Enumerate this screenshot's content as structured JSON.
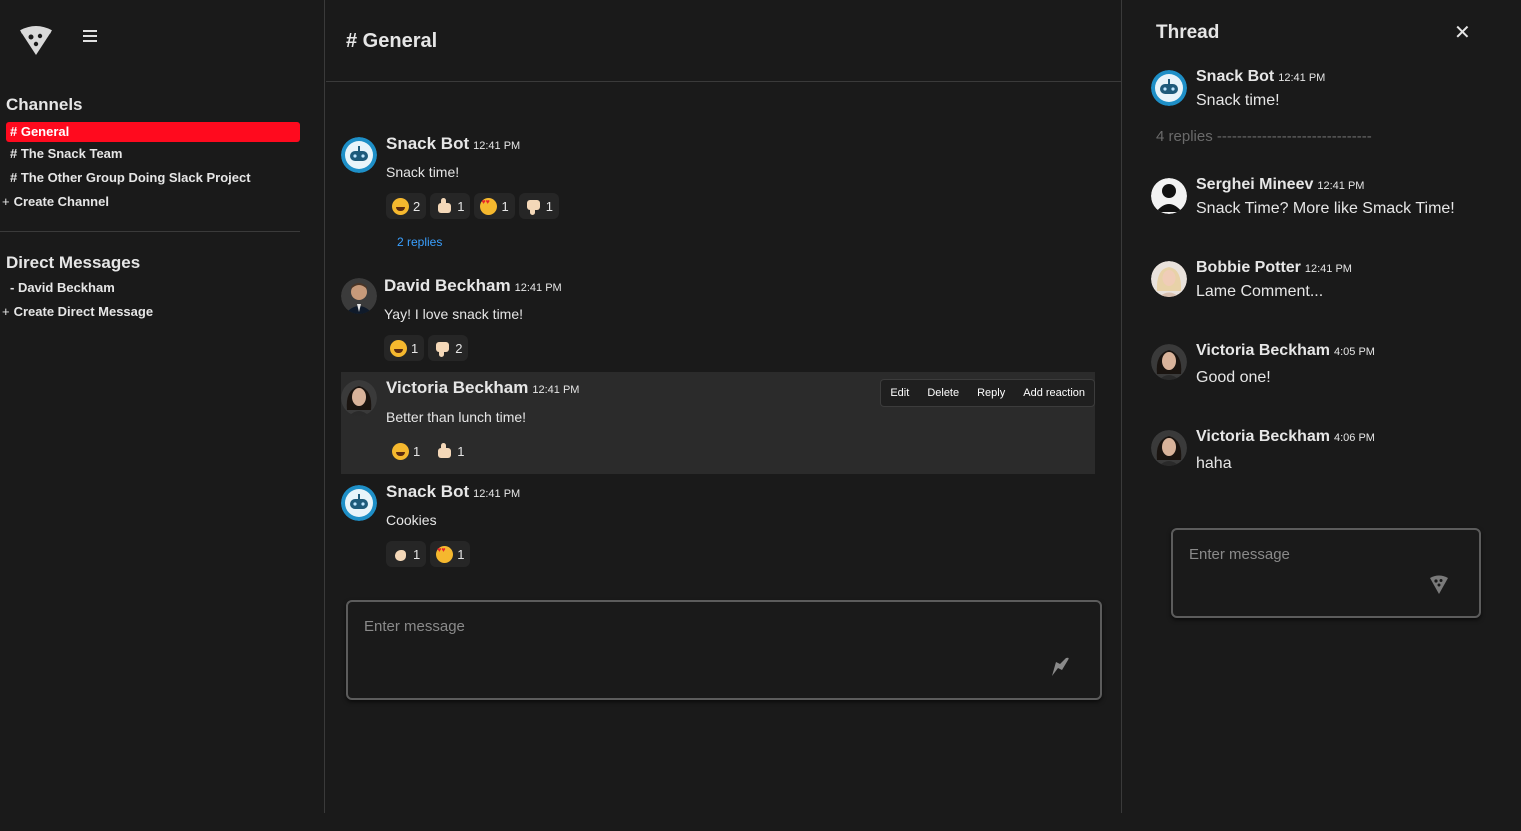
{
  "sidebar": {
    "channels_title": "Channels",
    "channels": [
      {
        "label": "# General",
        "active": true
      },
      {
        "label": "# The Snack Team",
        "active": false
      },
      {
        "label": "# The Other Group Doing Slack Project",
        "active": false
      }
    ],
    "create_channel": "Create Channel",
    "dm_title": "Direct Messages",
    "dms": [
      {
        "label": "- David Beckham"
      }
    ],
    "create_dm": "Create Direct Message",
    "plus": "+"
  },
  "main": {
    "title": "# General",
    "messages": [
      {
        "author": "Snack Bot",
        "time": "12:41 PM",
        "text": "Snack time!",
        "avatar": "robot-avatar",
        "reactions": [
          {
            "emoji": "laugh",
            "count": "2"
          },
          {
            "emoji": "thumbup",
            "count": "1"
          },
          {
            "emoji": "love",
            "count": "1"
          },
          {
            "emoji": "thumbdown",
            "count": "1"
          }
        ],
        "replies": "2 replies"
      },
      {
        "author": "David Beckham",
        "time": "12:41 PM",
        "text": "Yay! I love snack time!",
        "avatar": "photo-avatar",
        "reactions": [
          {
            "emoji": "laugh",
            "count": "1"
          },
          {
            "emoji": "thumbdown",
            "count": "2"
          }
        ]
      },
      {
        "author": "Victoria Beckham",
        "time": "12:41 PM",
        "text": "Better than lunch time!",
        "avatar": "photo-avatar",
        "reactions": [
          {
            "emoji": "laugh",
            "count": "1"
          },
          {
            "emoji": "thumbup",
            "count": "1"
          }
        ],
        "actions": [
          "Edit",
          "Delete",
          "Reply",
          "Add reaction"
        ]
      },
      {
        "author": "Snack Bot",
        "time": "12:41 PM",
        "text": "Cookies",
        "avatar": "robot-avatar",
        "reactions": [
          {
            "emoji": "pinch",
            "count": "1"
          },
          {
            "emoji": "love",
            "count": "1"
          }
        ]
      }
    ],
    "composer_placeholder": "Enter message"
  },
  "thread": {
    "title": "Thread",
    "close": "✕",
    "parent": {
      "author": "Snack Bot",
      "time": "12:41 PM",
      "text": "Snack time!"
    },
    "replies_label": "4 replies -------------------------------",
    "replies": [
      {
        "author": "Serghei Mineev",
        "time": "12:41 PM",
        "text": "Snack Time? More like Smack Time!"
      },
      {
        "author": "Bobbie Potter",
        "time": "12:41 PM",
        "text": "Lame Comment..."
      },
      {
        "author": "Victoria Beckham",
        "time": "4:05 PM",
        "text": "Good one!"
      },
      {
        "author": "Victoria Beckham",
        "time": "4:06 PM",
        "text": "haha"
      }
    ],
    "composer_placeholder": "Enter message"
  },
  "colors": {
    "accent": "#ff0a1e",
    "link": "#3aa0ff",
    "background": "#1a1a1a"
  }
}
